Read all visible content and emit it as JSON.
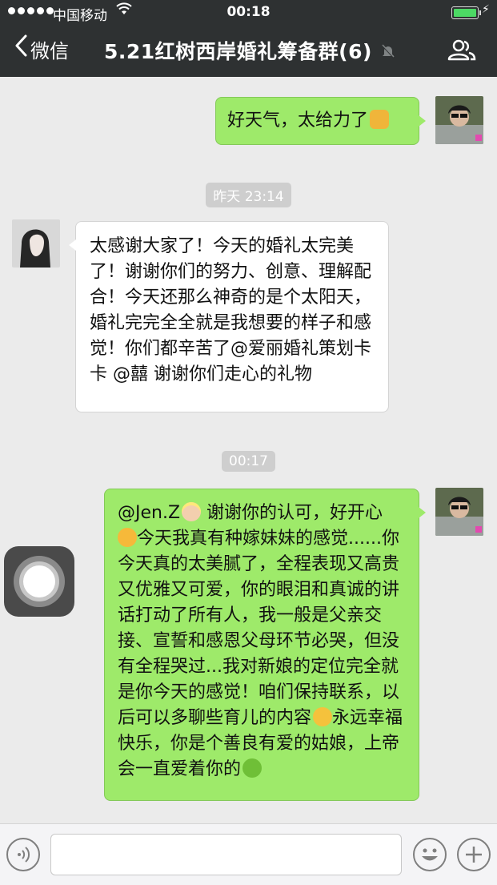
{
  "status_bar": {
    "carrier": "中国移动",
    "time": "00:18"
  },
  "nav": {
    "back_label": "微信",
    "title": "5.21红树西岸婚礼筹备群(6)"
  },
  "messages": [
    {
      "side": "right",
      "text": "好天气，太给力了"
    },
    {
      "side": "left",
      "text": "太感谢大家了！今天的婚礼太完美了！谢谢你们的努力、创意、理解配合！今天还那么神奇的是个太阳天，婚礼完完全全就是我想要的样子和感觉！你们都辛苦了@爱丽婚礼策划卡卡 @囍 谢谢你们走心的礼物"
    },
    {
      "side": "right",
      "lines": [
        "@Jen.Z",
        " 谢谢你的认可，好开心",
        "今天我真有种嫁妹妹的感觉......你今天真的太美腻了，全程表现又高贵又优雅又可爱，你的眼泪和真诚的讲话打动了所有人，我一般是父亲交接、宣誓和感恩父母环节必哭，但没有全程哭过...我对新娘的定位完全就是你今天的感觉！咱们保持联系，以后可以多聊些育儿的内容",
        "永远幸福快乐，你是个善良有爱的姑娘，上帝会一直爱着你的"
      ]
    }
  ],
  "timestamps": [
    "昨天 23:14",
    "00:17"
  ],
  "input": {
    "value": ""
  },
  "colors": {
    "nav_bg": "#2e3132",
    "chat_bg": "#ebebeb",
    "bubble_green": "#9eea6a",
    "bubble_white": "#ffffff"
  },
  "icons": [
    "back-chevron-icon",
    "mute-bell-icon",
    "group-members-icon",
    "voice-icon",
    "emoji-icon",
    "plus-icon",
    "assistive-touch-button"
  ]
}
